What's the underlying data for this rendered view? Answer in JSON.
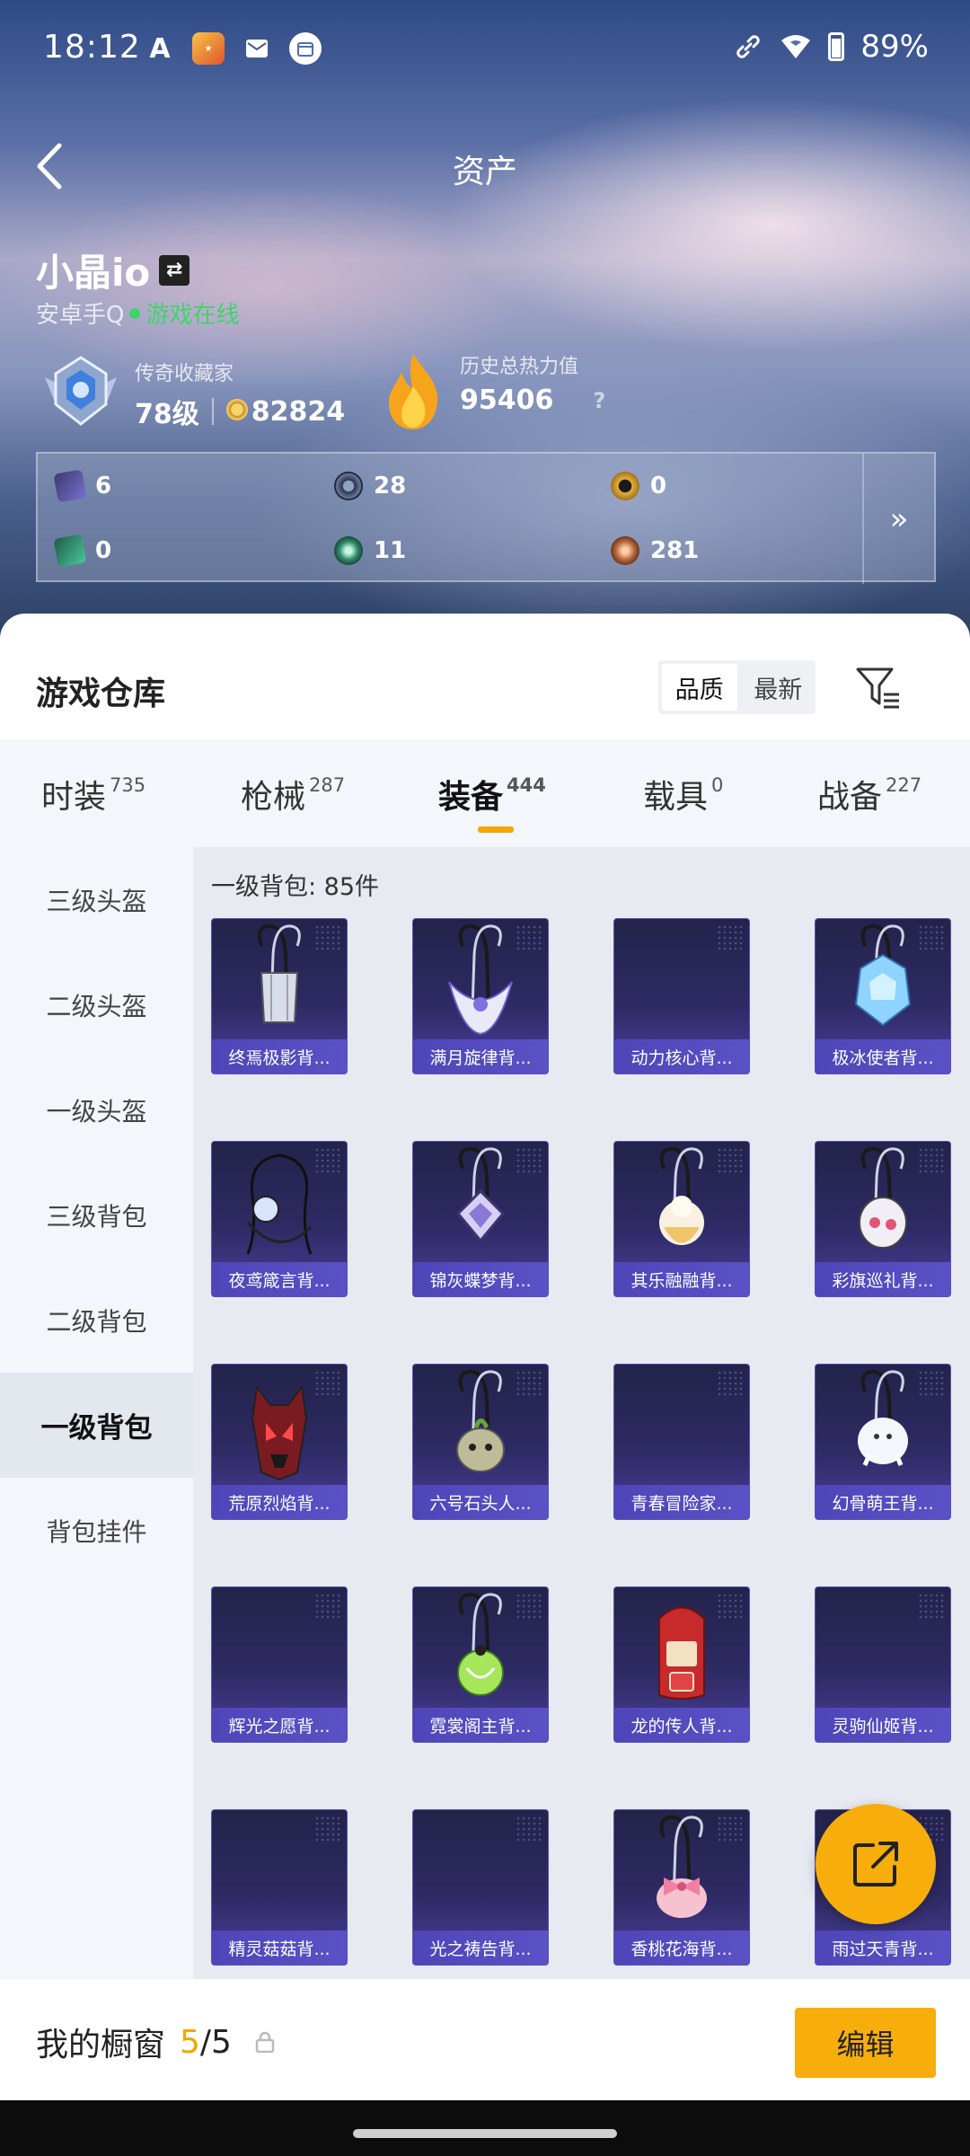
{
  "status_bar": {
    "time": "18:12",
    "battery": "89%"
  },
  "header": {
    "title": "资产"
  },
  "profile": {
    "name": "小晶io",
    "platform": "安卓手Q",
    "online_status": "游戏在线",
    "rank_label": "传奇收藏家",
    "level": "78级",
    "collection_points": "82824",
    "heat_label": "历史总热力值",
    "heat_value": "95406",
    "help": "?"
  },
  "resources": [
    {
      "icon": "purple-card-icon",
      "value": "6"
    },
    {
      "icon": "silver-disc-icon",
      "value": "28"
    },
    {
      "icon": "gold-disc-icon",
      "value": "0"
    },
    {
      "icon": "green-card-icon",
      "value": "0"
    },
    {
      "icon": "teal-orb-icon",
      "value": "11"
    },
    {
      "icon": "bronze-orb-icon",
      "value": "281"
    }
  ],
  "resources_more": "»",
  "warehouse": {
    "title": "游戏仓库",
    "sort_options": [
      "品质",
      "最新"
    ],
    "sort_selected": "品质"
  },
  "tabs": [
    {
      "label": "时装",
      "count": "735"
    },
    {
      "label": "枪械",
      "count": "287"
    },
    {
      "label": "装备",
      "count": "444"
    },
    {
      "label": "载具",
      "count": "0"
    },
    {
      "label": "战备",
      "count": "227"
    }
  ],
  "active_tab": "装备",
  "sidebar": [
    "三级头盔",
    "二级头盔",
    "一级头盔",
    "三级背包",
    "二级背包",
    "一级背包",
    "背包挂件"
  ],
  "sidebar_active": "一级背包",
  "list_count": "一级背包: 85件",
  "items": [
    {
      "name": "终焉极影背...",
      "art": "strap-cage"
    },
    {
      "name": "满月旋律背...",
      "art": "moon"
    },
    {
      "name": "动力核心背...",
      "art": "empty"
    },
    {
      "name": "极冰使者背...",
      "art": "ice"
    },
    {
      "name": "夜鸢箴言背...",
      "art": "whip"
    },
    {
      "name": "锦灰蝶梦背...",
      "art": "diamond"
    },
    {
      "name": "其乐融融背...",
      "art": "cream"
    },
    {
      "name": "彩旗巡礼背...",
      "art": "pinkbag"
    },
    {
      "name": "荒原烈焰背...",
      "art": "redmask"
    },
    {
      "name": "六号石头人...",
      "art": "stone"
    },
    {
      "name": "青春冒险家...",
      "art": "empty"
    },
    {
      "name": "幻骨萌王背...",
      "art": "white"
    },
    {
      "name": "辉光之愿背...",
      "art": "empty"
    },
    {
      "name": "霓裳阁主背...",
      "art": "green"
    },
    {
      "name": "龙的传人背...",
      "art": "redpack"
    },
    {
      "name": "灵驹仙姬背...",
      "art": "empty"
    },
    {
      "name": "精灵菇菇背...",
      "art": "empty"
    },
    {
      "name": "光之祷告背...",
      "art": "empty"
    },
    {
      "name": "香桃花海背...",
      "art": "pinkbow"
    },
    {
      "name": "雨过天青背...",
      "art": "empty"
    }
  ],
  "bottom": {
    "label": "我的橱窗",
    "current": "5",
    "total": "/5",
    "edit_label": "编辑"
  },
  "colors": {
    "accent": "#f7ad0c",
    "online": "#3fd46b",
    "item_bg": "#2e2a63"
  }
}
